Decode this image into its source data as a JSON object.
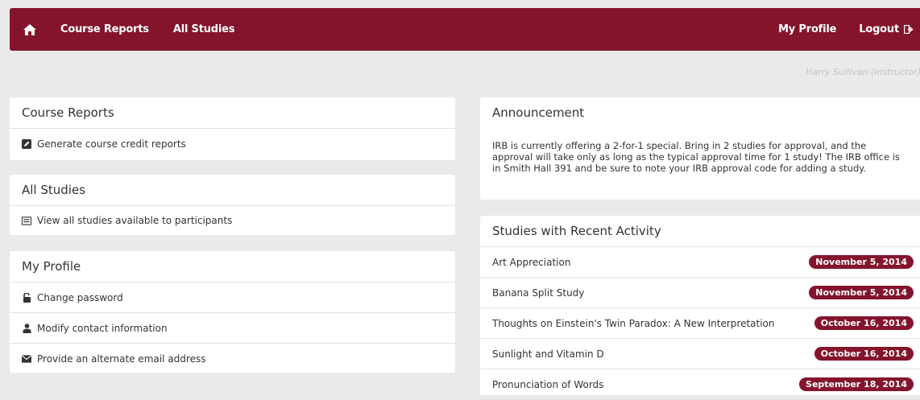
{
  "nav": {
    "home_icon": "home-icon",
    "course_reports": "Course Reports",
    "all_studies": "All Studies",
    "my_profile": "My Profile",
    "logout": "Logout",
    "logout_icon": "logout-icon",
    "bar_color": "#84142b"
  },
  "user": {
    "display": "Harry Sullivan (Instructor)"
  },
  "course_reports": {
    "title": "Course Reports",
    "items": [
      {
        "label": "Generate course credit reports",
        "icon": "edit-icon"
      }
    ]
  },
  "all_studies": {
    "title": "All Studies",
    "items": [
      {
        "label": "View all studies available to participants",
        "icon": "list-icon"
      }
    ]
  },
  "my_profile": {
    "title": "My Profile",
    "items": [
      {
        "label": "Change password",
        "icon": "unlock-icon"
      },
      {
        "label": "Modify contact information",
        "icon": "user-icon"
      },
      {
        "label": "Provide an alternate email address",
        "icon": "envelope-icon"
      }
    ]
  },
  "announcement": {
    "title": "Announcement",
    "body": "IRB is currently offering a 2-for-1 special. Bring in 2 studies for approval, and the approval will take only as long as the typical approval time for 1 study! The IRB office is in Smith Hall 391 and be sure to note your IRB approval code for adding a study."
  },
  "recent_activity": {
    "title": "Studies with Recent Activity",
    "rows": [
      {
        "name": "Art Appreciation",
        "date": "November 5, 2014"
      },
      {
        "name": "Banana Split Study",
        "date": "November 5, 2014"
      },
      {
        "name": "Thoughts on Einstein's Twin Paradox: A New Interpretation",
        "date": "October 16, 2014"
      },
      {
        "name": "Sunlight and Vitamin D",
        "date": "October 16, 2014"
      },
      {
        "name": "Pronunciation of Words",
        "date": "September 18, 2014"
      }
    ]
  }
}
